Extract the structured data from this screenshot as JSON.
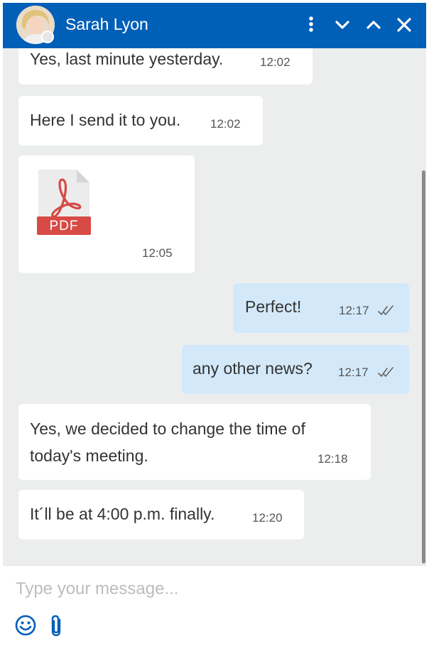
{
  "header": {
    "contact_name": "Sarah Lyon",
    "status": "offline",
    "icons": [
      "more-vertical-icon",
      "chevron-down-icon",
      "chevron-up-icon",
      "close-icon"
    ]
  },
  "messages": [
    {
      "direction": "in",
      "text": "Yes, last minute yesterday.",
      "time": "12:02"
    },
    {
      "direction": "in",
      "text": "Here I send it to you.",
      "time": "12:02"
    },
    {
      "direction": "in",
      "type": "file",
      "file_label": "PDF",
      "time": "12:05"
    },
    {
      "direction": "out",
      "text": "Perfect!",
      "time": "12:17",
      "status": "read"
    },
    {
      "direction": "out",
      "text": "any other news?",
      "time": "12:17",
      "status": "read"
    },
    {
      "direction": "in",
      "text": "Yes, we decided to change the time of today's meeting.",
      "time": "12:18"
    },
    {
      "direction": "in",
      "text": "It´ll be at 4:00 p.m. finally.",
      "time": "12:20"
    }
  ],
  "composer": {
    "placeholder": "Type your message...",
    "value": "",
    "icons": [
      "emoji-icon",
      "paperclip-icon"
    ]
  },
  "colors": {
    "header": "#005fb7",
    "chat_background": "#eceeee",
    "incoming_bubble": "#ffffff",
    "outgoing_bubble": "#d3e9fa",
    "pdf_red": "#d74a45"
  }
}
